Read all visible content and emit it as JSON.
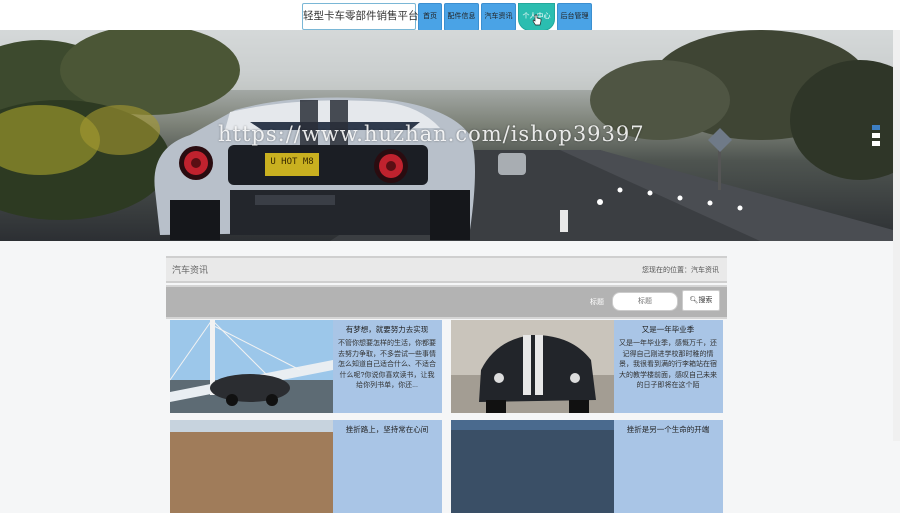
{
  "header": {
    "site_title": "轻型卡车零部件销售平台",
    "nav": [
      {
        "label": "首页"
      },
      {
        "label": "配件信息"
      },
      {
        "label": "汽车资讯"
      },
      {
        "label": "个人中心"
      },
      {
        "label": "后台管理"
      }
    ]
  },
  "banner": {
    "watermark": "https://www.huzhan.com/ishop39397",
    "plate": "U HOT M8",
    "slide_count": 3,
    "active_slide": 1
  },
  "breadcrumb": {
    "section": "汽车资讯",
    "location_label": "您现在的位置：",
    "location_value": "汽车资讯"
  },
  "search": {
    "label": "标题",
    "placeholder": "标题",
    "button": "搜索"
  },
  "articles": [
    {
      "title": "有梦想，就要努力去实现",
      "body": "不管你想要怎样的生活，你都要去努力争取，不多尝试一些事情怎么知道自己适合什么、不适合什么呢?你说你喜欢读书，让我给你列书单，你还..."
    },
    {
      "title": "又是一年毕业季",
      "body": "又是一年毕业季，感慨万千，还记得自己刚进学校那时稚的情景，我很看到满的行李箱站在宿大的教学楼前面，感叹自己未来的日子即将在这个陌"
    },
    {
      "title": "挫折路上，坚持常在心间",
      "body": ""
    },
    {
      "title": "挫折是另一个生命的开端",
      "body": ""
    }
  ],
  "colors": {
    "nav_blue": "#4aa3e6",
    "nav_active": "#2bbdb0",
    "card_bg": "#a9c5e6",
    "search_bar": "#b3b3b3"
  }
}
